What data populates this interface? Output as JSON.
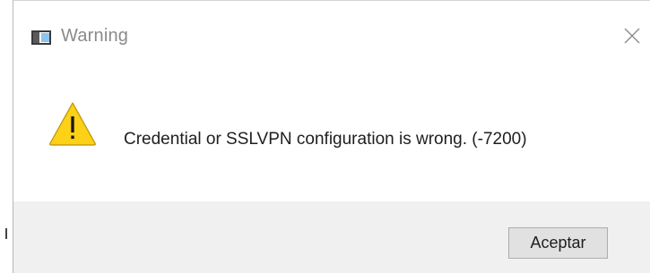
{
  "dialog": {
    "title": "Warning",
    "message": "Credential or SSLVPN configuration is wrong. (-7200)",
    "buttons": {
      "accept_label": "Aceptar"
    },
    "icons": {
      "app": "app-window-icon",
      "warning": "warning-triangle-icon",
      "close": "close-icon"
    },
    "colors": {
      "warning_fill": "#fcd116",
      "footer_bg": "#f0f0f0",
      "button_bg": "#e1e1e1"
    }
  }
}
